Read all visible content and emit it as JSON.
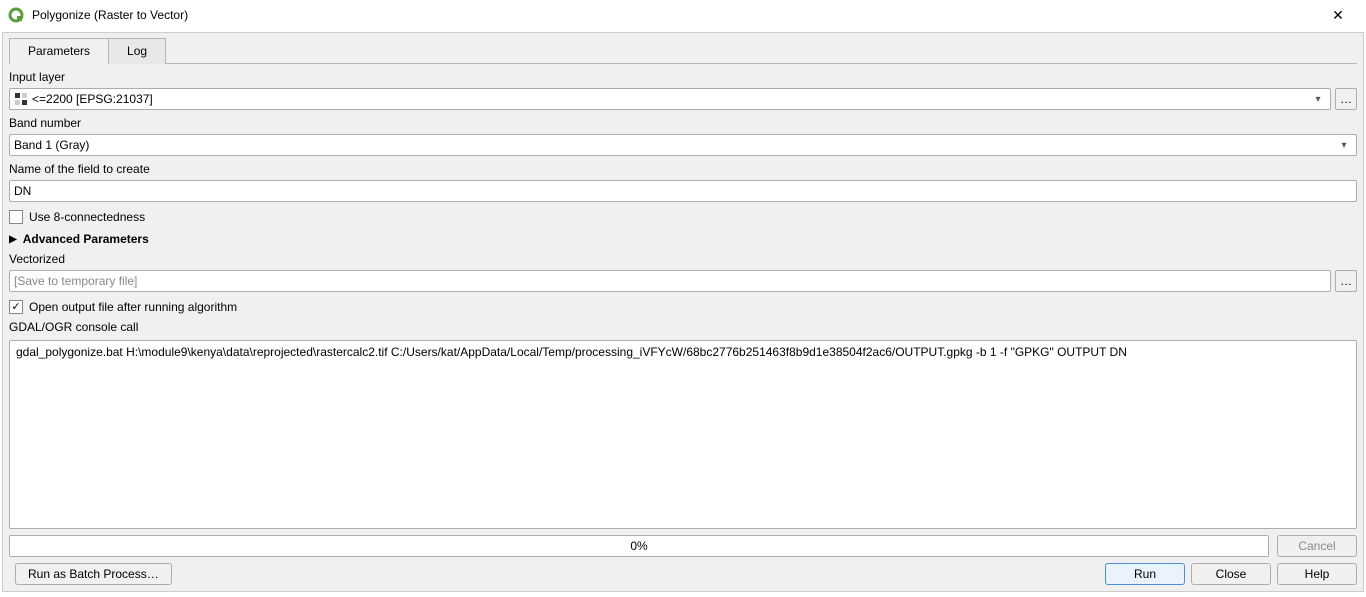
{
  "window": {
    "title": "Polygonize (Raster to Vector)"
  },
  "tabs": {
    "parameters": "Parameters",
    "log": "Log"
  },
  "labels": {
    "input_layer": "Input layer",
    "band_number": "Band number",
    "field_name": "Name of the field to create",
    "use_8conn": "Use 8-connectedness",
    "advanced": "Advanced Parameters",
    "vectorized": "Vectorized",
    "open_after": "Open output file after running algorithm",
    "console_call": "GDAL/OGR console call"
  },
  "values": {
    "input_layer": "<=2200 [EPSG:21037]",
    "band_number": "Band 1 (Gray)",
    "field_name": "DN",
    "vectorized_placeholder": "[Save to temporary file]",
    "console": "gdal_polygonize.bat H:\\module9\\kenya\\data\\reprojected\\rastercalc2.tif C:/Users/kat/AppData/Local/Temp/processing_iVFYcW/68bc2776b251463f8b9d1e38504f2ac6/OUTPUT.gpkg -b 1 -f \"GPKG\" OUTPUT DN"
  },
  "checkboxes": {
    "use_8conn": false,
    "open_after": true
  },
  "progress": "0%",
  "buttons": {
    "cancel": "Cancel",
    "batch": "Run as Batch Process…",
    "run": "Run",
    "close": "Close",
    "help": "Help",
    "browse": "…"
  }
}
